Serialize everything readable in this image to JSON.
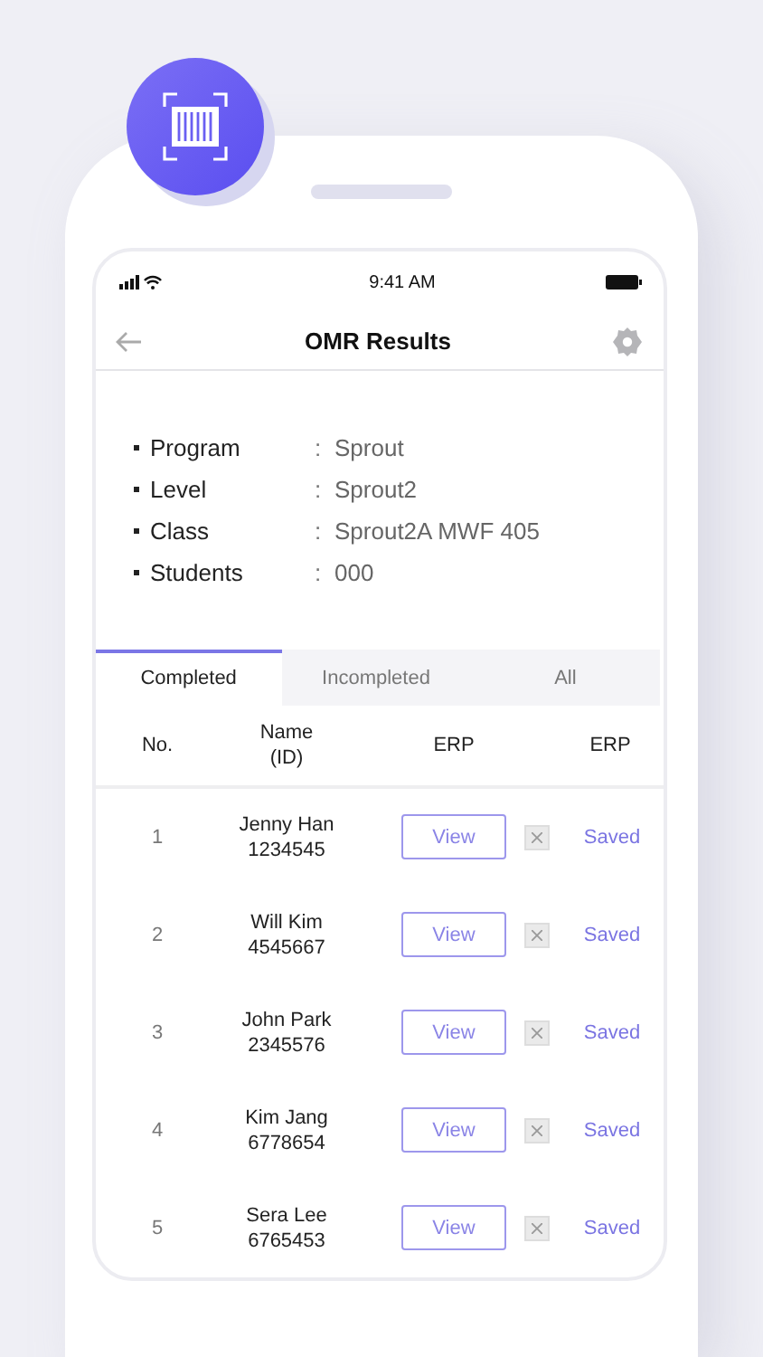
{
  "status_bar": {
    "time": "9:41 AM"
  },
  "header": {
    "title": "OMR Results"
  },
  "info": [
    {
      "label": "Program",
      "separator": ":",
      "value": "Sprout"
    },
    {
      "label": "Level",
      "separator": ":",
      "value": "Sprout2"
    },
    {
      "label": "Class",
      "separator": ":",
      "value": "Sprout2A MWF 405"
    },
    {
      "label": "Students",
      "separator": ":",
      "value": "000"
    }
  ],
  "tabs": [
    {
      "label": "Completed",
      "selected": true
    },
    {
      "label": "Incompleted",
      "selected": false
    },
    {
      "label": "All",
      "selected": false
    }
  ],
  "table": {
    "columns": [
      "No.",
      "Name\n(ID)",
      "ERP",
      "ERP"
    ],
    "rows": [
      {
        "no": "1",
        "name": "Jenny Han",
        "id": "1234545",
        "action": "View",
        "status": "Saved"
      },
      {
        "no": "2",
        "name": "Will Kim",
        "id": "4545667",
        "action": "View",
        "status": "Saved"
      },
      {
        "no": "3",
        "name": "John Park",
        "id": "2345576",
        "action": "View",
        "status": "Saved"
      },
      {
        "no": "4",
        "name": "Kim Jang",
        "id": "6778654",
        "action": "View",
        "status": "Saved"
      },
      {
        "no": "5",
        "name": "Sera Lee",
        "id": "6765453",
        "action": "View",
        "status": "Saved"
      }
    ]
  }
}
